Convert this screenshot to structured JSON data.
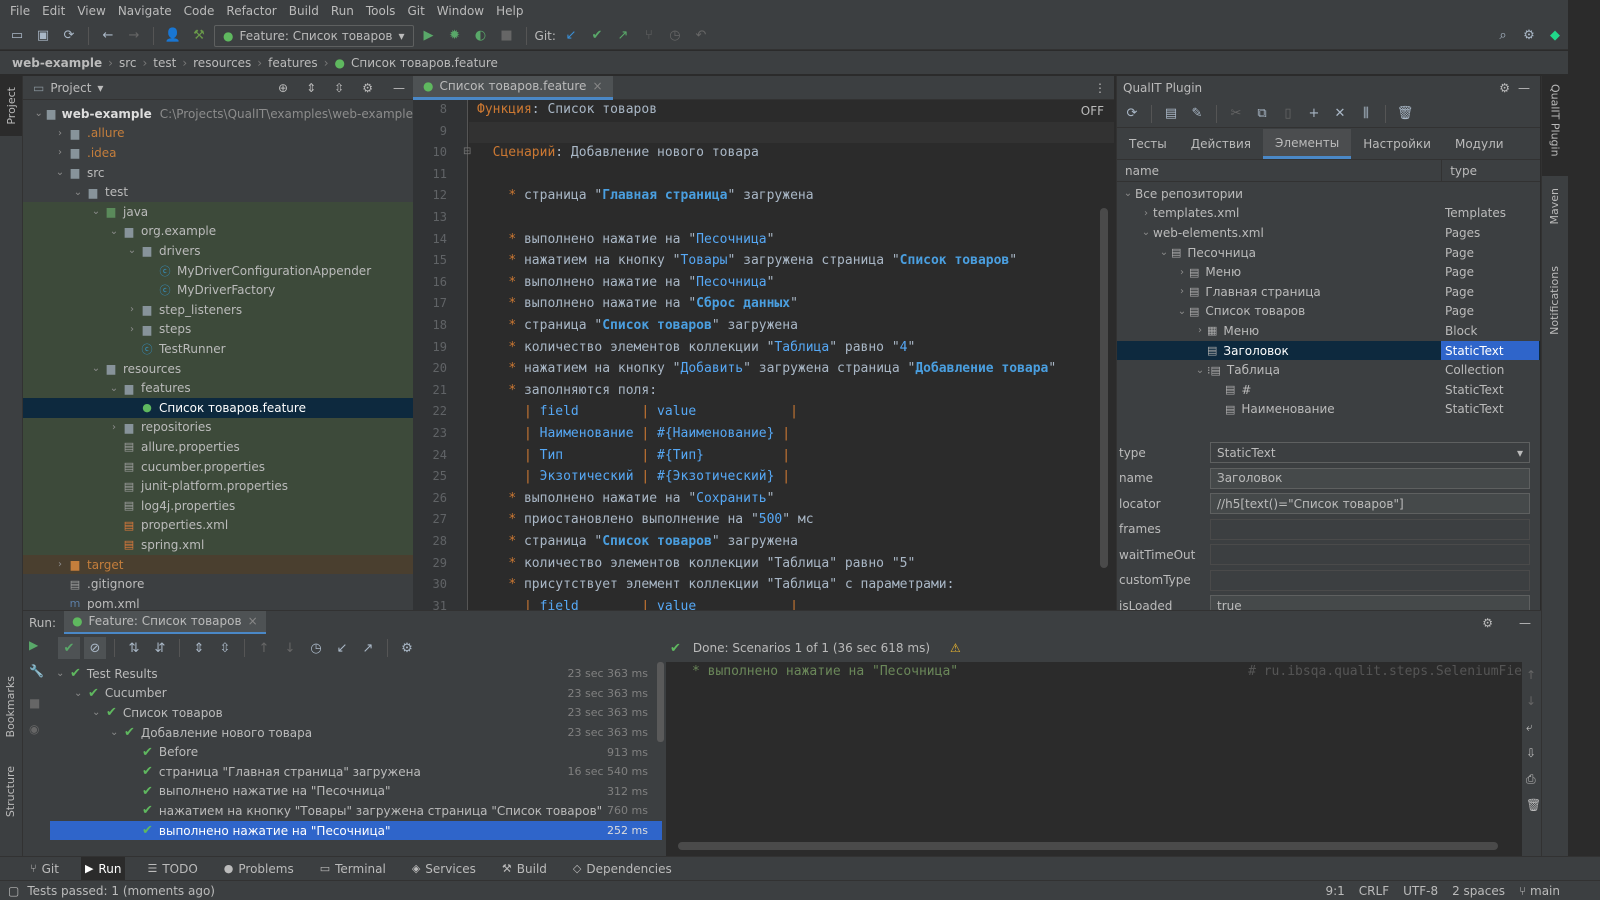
{
  "menu": [
    "File",
    "Edit",
    "View",
    "Navigate",
    "Code",
    "Refactor",
    "Build",
    "Run",
    "Tools",
    "Git",
    "Window",
    "Help"
  ],
  "toolbar": {
    "run_config": "Feature: Список товаров",
    "git_label": "Git:"
  },
  "breadcrumbs": [
    "web-example",
    "src",
    "test",
    "resources",
    "features",
    "Список товаров.feature"
  ],
  "left_stripe": {
    "project": "Project",
    "bookmarks": "Bookmarks",
    "structure": "Structure"
  },
  "project": {
    "title": "Project",
    "tree": [
      {
        "indent": 0,
        "arrow": "⌄",
        "label": "web-example",
        "path": "C:\\Projects\\QualIT\\examples\\web-example",
        "icon": "folder",
        "bold": true
      },
      {
        "indent": 1,
        "arrow": "›",
        "label": ".allure",
        "icon": "folder",
        "ignored": true
      },
      {
        "indent": 1,
        "arrow": "›",
        "label": ".idea",
        "icon": "folder",
        "ignored": true
      },
      {
        "indent": 1,
        "arrow": "⌄",
        "label": "src",
        "icon": "folder"
      },
      {
        "indent": 2,
        "arrow": "⌄",
        "label": "test",
        "icon": "folder"
      },
      {
        "indent": 3,
        "arrow": "⌄",
        "label": "java",
        "icon": "folder-green",
        "green": true
      },
      {
        "indent": 4,
        "arrow": "⌄",
        "label": "org.example",
        "icon": "folder",
        "green": true
      },
      {
        "indent": 5,
        "arrow": "⌄",
        "label": "drivers",
        "icon": "folder",
        "green": true
      },
      {
        "indent": 6,
        "arrow": "",
        "label": "MyDriverConfigurationAppender",
        "icon": "class",
        "green": true
      },
      {
        "indent": 6,
        "arrow": "",
        "label": "MyDriverFactory",
        "icon": "class",
        "green": true
      },
      {
        "indent": 5,
        "arrow": "›",
        "label": "step_listeners",
        "icon": "folder",
        "green": true
      },
      {
        "indent": 5,
        "arrow": "›",
        "label": "steps",
        "icon": "folder",
        "green": true
      },
      {
        "indent": 5,
        "arrow": "",
        "label": "TestRunner",
        "icon": "class",
        "green": true
      },
      {
        "indent": 3,
        "arrow": "⌄",
        "label": "resources",
        "icon": "folder",
        "green": true
      },
      {
        "indent": 4,
        "arrow": "⌄",
        "label": "features",
        "icon": "folder",
        "green": true
      },
      {
        "indent": 5,
        "arrow": "",
        "label": "Список товаров.feature",
        "icon": "feature",
        "selected": true
      },
      {
        "indent": 4,
        "arrow": "›",
        "label": "repositories",
        "icon": "folder",
        "green": true
      },
      {
        "indent": 4,
        "arrow": "",
        "label": "allure.properties",
        "icon": "props",
        "green": true
      },
      {
        "indent": 4,
        "arrow": "",
        "label": "cucumber.properties",
        "icon": "props",
        "green": true
      },
      {
        "indent": 4,
        "arrow": "",
        "label": "junit-platform.properties",
        "icon": "props",
        "green": true
      },
      {
        "indent": 4,
        "arrow": "",
        "label": "log4j.properties",
        "icon": "props",
        "green": true
      },
      {
        "indent": 4,
        "arrow": "",
        "label": "properties.xml",
        "icon": "xml",
        "green": true
      },
      {
        "indent": 4,
        "arrow": "",
        "label": "spring.xml",
        "icon": "xml",
        "green": true
      },
      {
        "indent": 1,
        "arrow": "›",
        "label": "target",
        "icon": "folder-orange",
        "ignored": true,
        "tint": true
      },
      {
        "indent": 1,
        "arrow": "",
        "label": ".gitignore",
        "icon": "file"
      },
      {
        "indent": 1,
        "arrow": "",
        "label": "pom.xml",
        "icon": "maven"
      }
    ]
  },
  "editor": {
    "tab": "Список товаров.feature",
    "off_label": "OFF",
    "lines": [
      {
        "n": "8",
        "html": "<span class='kw'>Функция</span>: Список товаров"
      },
      {
        "n": "9",
        "html": ""
      },
      {
        "n": "10",
        "html": "  <span class='kw'>Сценарий</span>: Добавление нового товара"
      },
      {
        "n": "11",
        "html": ""
      },
      {
        "n": "12",
        "html": "    <span class='kw'>*</span> страница \"<span class='link'>Главная страница</span>\" загружена"
      },
      {
        "n": "13",
        "html": ""
      },
      {
        "n": "14",
        "html": "    <span class='kw'>*</span> выполнено нажатие на \"<span class='param'>Песочница</span>\""
      },
      {
        "n": "15",
        "html": "    <span class='kw'>*</span> нажатием на кнопку \"<span class='param'>Товары</span>\" загружена страница \"<span class='link'>Список товаров</span>\""
      },
      {
        "n": "16",
        "html": "    <span class='kw'>*</span> выполнено нажатие на \"<span class='param'>Песочница</span>\""
      },
      {
        "n": "17",
        "html": "    <span class='kw'>*</span> выполнено нажатие на \"<span class='link'>Сброс данных</span>\""
      },
      {
        "n": "18",
        "html": "    <span class='kw'>*</span> страница \"<span class='link'>Список товаров</span>\" загружена"
      },
      {
        "n": "19",
        "html": "    <span class='kw'>*</span> количество элементов коллекции \"<span class='param'>Таблица</span>\" равно \"<span class='param'>4</span>\""
      },
      {
        "n": "20",
        "html": "    <span class='kw'>*</span> нажатием на кнопку \"<span class='param'>Добавить</span>\" загружена страница \"<span class='link'>Добавление товара</span>\""
      },
      {
        "n": "21",
        "html": "    <span class='kw'>*</span> заполняются поля:"
      },
      {
        "n": "22",
        "html": "      <span class='pipe'>|</span> <span class='param'>field</span>        <span class='pipe'>|</span> <span class='param'>value</span>            <span class='pipe'>|</span>"
      },
      {
        "n": "23",
        "html": "      <span class='pipe'>|</span> <span class='param'>Наименование</span> <span class='pipe'>|</span> <span class='param'>#{Наименование}</span> <span class='pipe'>|</span>"
      },
      {
        "n": "24",
        "html": "      <span class='pipe'>|</span> <span class='param'>Тип</span>          <span class='pipe'>|</span> <span class='param'>#{Тип}</span>          <span class='pipe'>|</span>"
      },
      {
        "n": "25",
        "html": "      <span class='pipe'>|</span> <span class='param'>Экзотический</span> <span class='pipe'>|</span> <span class='param'>#{Экзотический}</span> <span class='pipe'>|</span>"
      },
      {
        "n": "26",
        "html": "    <span class='kw'>*</span> выполнено нажатие на \"<span class='param'>Сохранить</span>\""
      },
      {
        "n": "27",
        "html": "    <span class='kw'>*</span> приостановлено выполнение на \"<span class='param'>500</span>\" мс"
      },
      {
        "n": "28",
        "html": "    <span class='kw'>*</span> страница \"<span class='link'>Список товаров</span>\" загружена"
      },
      {
        "n": "29",
        "html": "    <span class='kw'>*</span> количество элементов коллекции \"Таблица\" равно \"5\""
      },
      {
        "n": "30",
        "html": "    <span class='kw'>*</span> присутствует элемент коллекции \"Таблица\" с параметрами:"
      },
      {
        "n": "31",
        "html": "      <span class='pipe'>|</span> <span class='param'>field</span>        <span class='pipe'>|</span> <span class='param'>value</span>            <span class='pipe'>|</span>"
      }
    ]
  },
  "plugin": {
    "title": "QualIT Plugin",
    "tabs": [
      "Тесты",
      "Действия",
      "Элементы",
      "Настройки",
      "Модули"
    ],
    "active_tab": "Элементы",
    "col_name": "name",
    "col_type": "type",
    "tree": [
      {
        "indent": 0,
        "arrow": "⌄",
        "label": "Все репозитории",
        "type": ""
      },
      {
        "indent": 1,
        "arrow": "›",
        "label": "templates.xml",
        "type": "Templates"
      },
      {
        "indent": 1,
        "arrow": "⌄",
        "label": "web-elements.xml",
        "type": "Pages"
      },
      {
        "indent": 2,
        "arrow": "⌄",
        "label": "Песочница",
        "type": "Page",
        "icon": "page"
      },
      {
        "indent": 3,
        "arrow": "›",
        "label": "Меню",
        "type": "Page",
        "icon": "page"
      },
      {
        "indent": 3,
        "arrow": "›",
        "label": "Главная страница",
        "type": "Page",
        "icon": "page"
      },
      {
        "indent": 3,
        "arrow": "⌄",
        "label": "Список товаров",
        "type": "Page",
        "icon": "page"
      },
      {
        "indent": 4,
        "arrow": "›",
        "label": "Меню",
        "type": "Block",
        "icon": "block"
      },
      {
        "indent": 4,
        "arrow": "",
        "label": "Заголовок",
        "type": "StaticText",
        "icon": "text",
        "selected": true
      },
      {
        "indent": 4,
        "arrow": "⌄",
        "label": "Таблица",
        "type": "Collection",
        "icon": "coll"
      },
      {
        "indent": 5,
        "arrow": "",
        "label": "#",
        "type": "StaticText",
        "icon": "text"
      },
      {
        "indent": 5,
        "arrow": "",
        "label": "Наименование",
        "type": "StaticText",
        "icon": "text"
      }
    ],
    "props": [
      {
        "label": "type",
        "value": "StaticText",
        "dropdown": true
      },
      {
        "label": "name",
        "value": "Заголовок"
      },
      {
        "label": "locator",
        "value": "//h5[text()=\"Список товаров\"]"
      },
      {
        "label": "frames",
        "value": ""
      },
      {
        "label": "waitTimeOut",
        "value": ""
      },
      {
        "label": "customType",
        "value": ""
      },
      {
        "label": "isLoaded",
        "value": "true"
      }
    ]
  },
  "right_stripe": {
    "plugin": "QualIT Plugin",
    "maven": "Maven",
    "notifications": "Notifications"
  },
  "run": {
    "label": "Run:",
    "tab": "Feature: Список товаров",
    "status": "Done: Scenarios 1 of 1 (36 sec 618 ms)",
    "console_line": "* выполнено нажатие на \"Песочница\"",
    "console_comment": "# ru.ibsqa.qualit.steps.SeleniumFie",
    "tree": [
      {
        "indent": 0,
        "label": "Test Results",
        "time": "23 sec 363 ms"
      },
      {
        "indent": 1,
        "label": "Cucumber",
        "time": "23 sec 363 ms"
      },
      {
        "indent": 2,
        "label": "Список товаров",
        "time": "23 sec 363 ms"
      },
      {
        "indent": 3,
        "label": "Добавление нового товара",
        "time": "23 sec 363 ms"
      },
      {
        "indent": 4,
        "label": "Before",
        "time": "913 ms"
      },
      {
        "indent": 4,
        "label": "страница \"Главная страница\" загружена",
        "time": "16 sec 540 ms"
      },
      {
        "indent": 4,
        "label": "выполнено нажатие на \"Песочница\"",
        "time": "312 ms"
      },
      {
        "indent": 4,
        "label": "нажатием на кнопку \"Товары\" загружена страница \"Список товаров\"",
        "time": "760 ms"
      },
      {
        "indent": 4,
        "label": "выполнено нажатие на \"Песочница\"",
        "time": "252 ms",
        "selected": true
      }
    ]
  },
  "tool_tabs": [
    "Git",
    "Run",
    "TODO",
    "Problems",
    "Terminal",
    "Services",
    "Build",
    "Dependencies"
  ],
  "status": {
    "left": "Tests passed: 1 (moments ago)",
    "position": "9:1",
    "line_sep": "CRLF",
    "encoding": "UTF-8",
    "indent": "2 spaces",
    "branch": "main"
  }
}
